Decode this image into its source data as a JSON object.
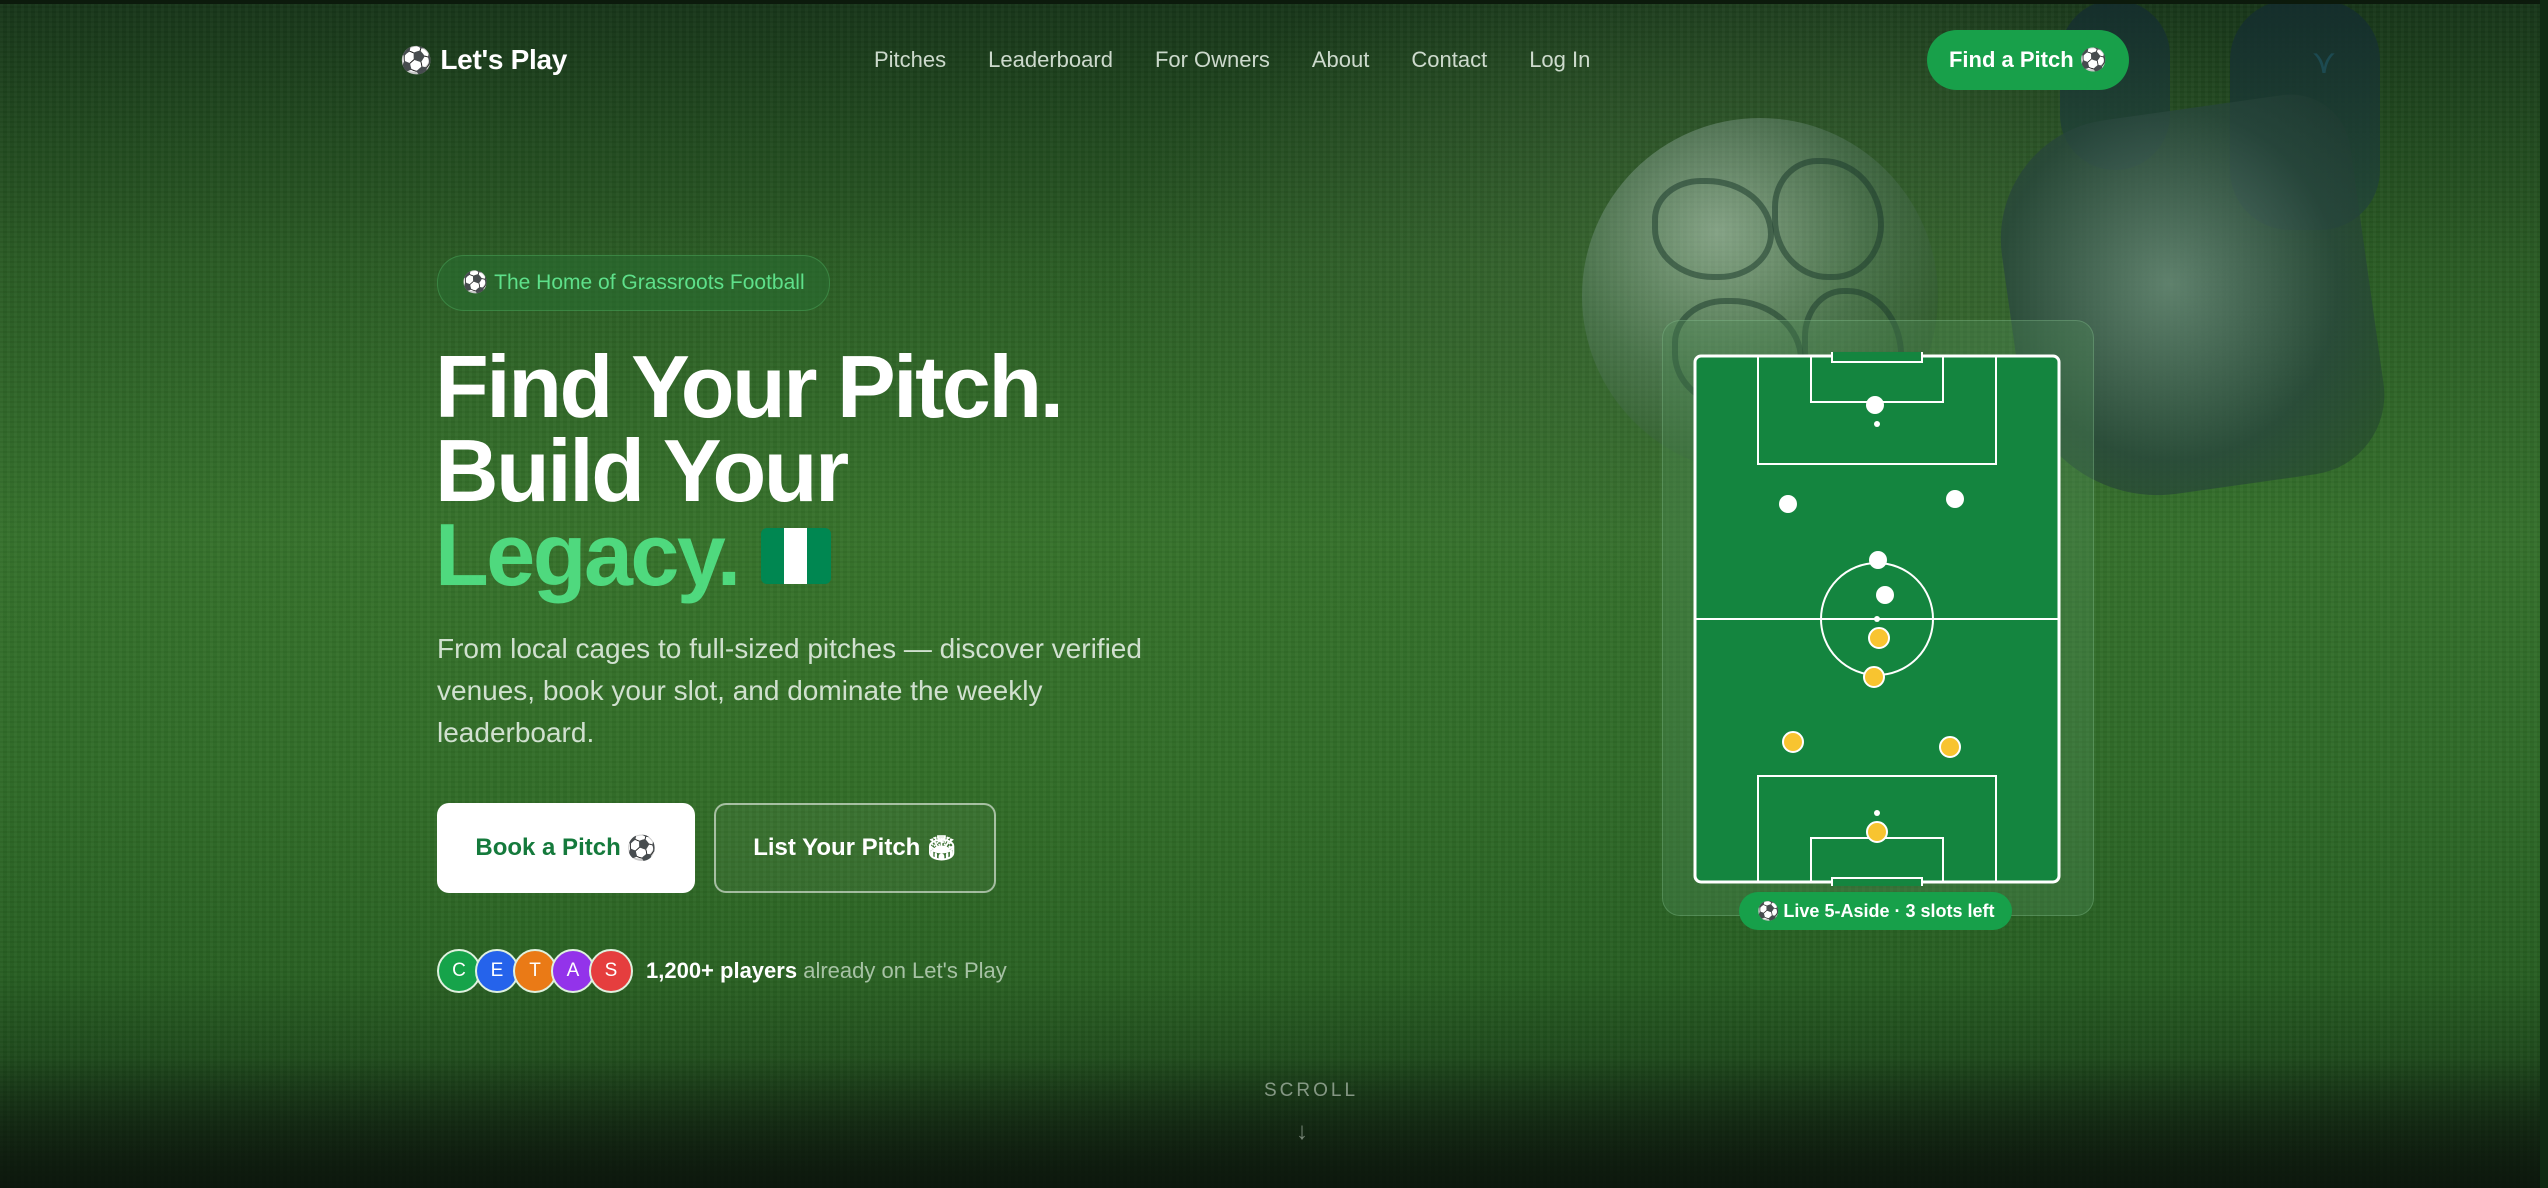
{
  "brand": {
    "icon": "soccer-ball-icon",
    "icon_glyph": "⚽",
    "name": "Let's Play"
  },
  "nav": {
    "links": [
      "Pitches",
      "Leaderboard",
      "For Owners",
      "About",
      "Contact",
      "Log In"
    ],
    "cta": {
      "label": "Find a Pitch",
      "icon_glyph": "⚽"
    }
  },
  "hero": {
    "badge": {
      "icon_glyph": "⚽",
      "label": "The Home of Grassroots Football"
    },
    "headline": {
      "line1": "Find Your Pitch.",
      "line2": "Build Your",
      "line3": "Legacy.",
      "flag": "nigeria-flag-icon"
    },
    "lead": "From local cages to full-sized pitches — discover verified venues, book your slot, and dominate the weekly leaderboard.",
    "primary_button": {
      "label": "Book a Pitch",
      "icon_glyph": "⚽"
    },
    "secondary_button": {
      "label": "List Your Pitch",
      "icon_glyph": "🏟"
    },
    "social_proof": {
      "avatars": [
        {
          "initial": "C",
          "color": "#16a34a"
        },
        {
          "initial": "E",
          "color": "#2563eb"
        },
        {
          "initial": "T",
          "color": "#ea7a16"
        },
        {
          "initial": "A",
          "color": "#9333ea"
        },
        {
          "initial": "S",
          "color": "#e53e3e"
        }
      ],
      "count": "1,200+ players",
      "suffix": "already on Let's Play"
    },
    "scroll": {
      "label": "SCROLL",
      "arrow": "↓"
    }
  },
  "pitch_card": {
    "live_label": "Live 5-Aside · 3 slots left",
    "live_icon_glyph": "⚽"
  },
  "colors": {
    "accent": "#4fd97e",
    "brand_green": "#18a04a",
    "pitch_green": "#14853f",
    "player_white": "#ffffff",
    "player_yellow": "#f8c430",
    "flag_green": "#008751"
  }
}
